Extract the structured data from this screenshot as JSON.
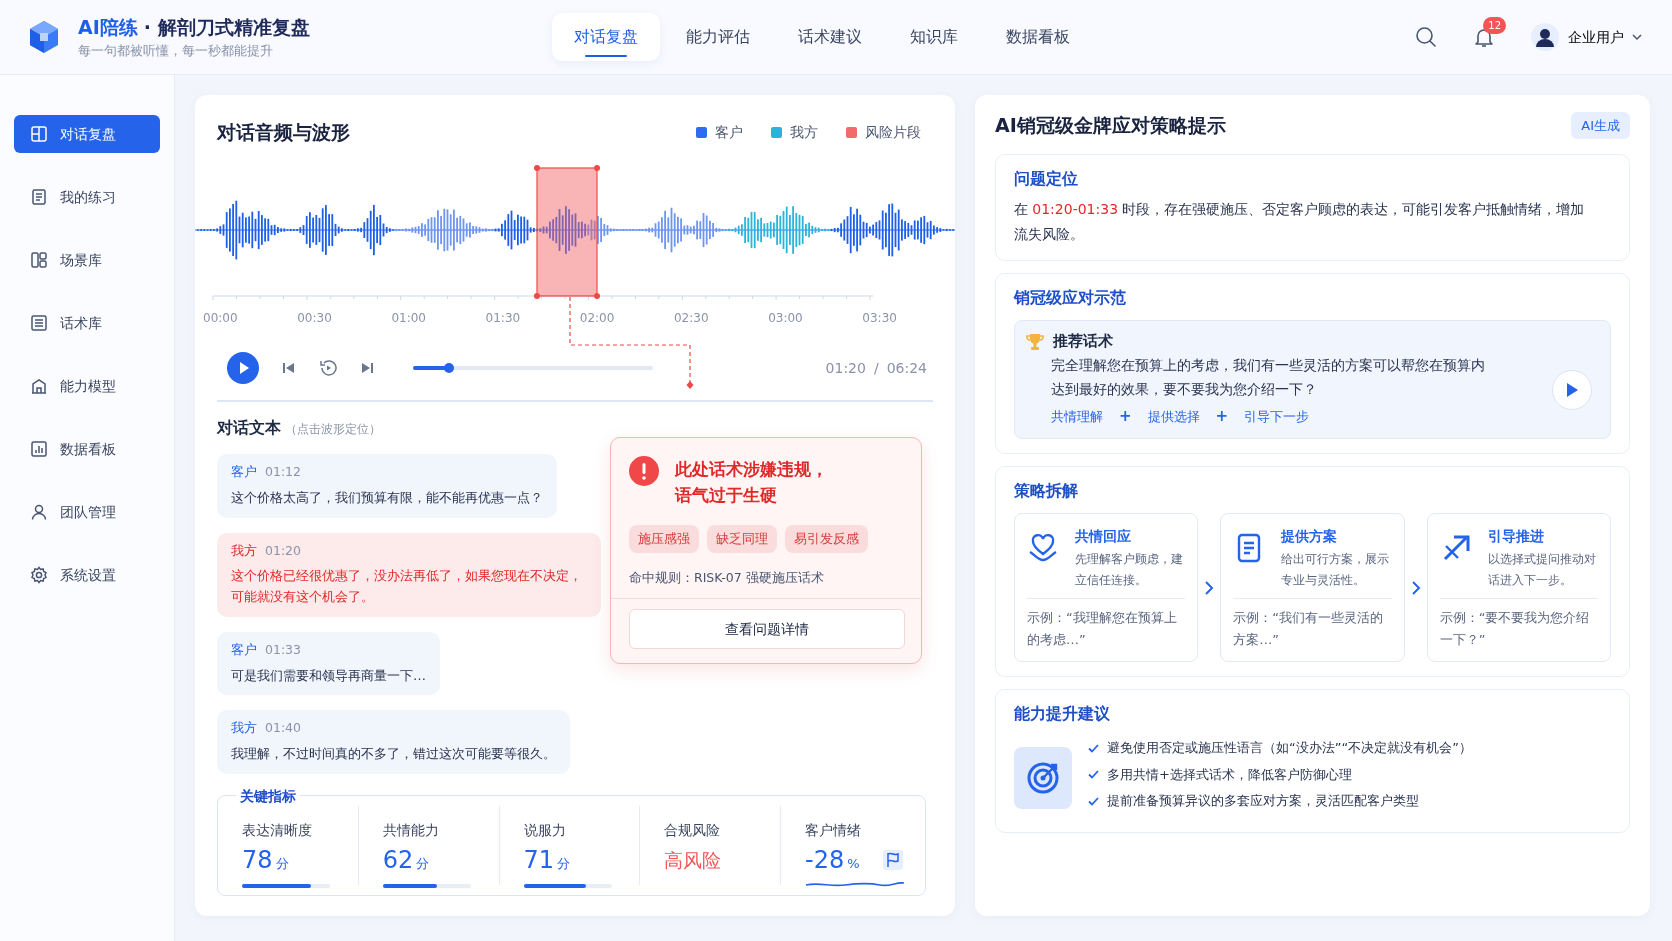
{
  "header": {
    "brand": "AI陪练",
    "title": "· 解剖刀式精准复盘",
    "subtitle": "每一句都被听懂，每一秒都能提升",
    "tabs": [
      {
        "label": "对话复盘",
        "selected": true
      },
      {
        "label": "能力评估",
        "selected": false
      },
      {
        "label": "话术建议",
        "selected": false
      },
      {
        "label": "知识库",
        "selected": false
      },
      {
        "label": "数据看板",
        "selected": false
      }
    ],
    "notification_count": "12",
    "user": "企业用户"
  },
  "sidebar": {
    "items": [
      {
        "label": "对话复盘",
        "selected": true
      },
      {
        "label": "我的练习",
        "selected": false
      },
      {
        "label": "场景库",
        "selected": false
      },
      {
        "label": "话术库",
        "selected": false
      },
      {
        "label": "能力模型",
        "selected": false
      },
      {
        "label": "数据看板",
        "selected": false
      },
      {
        "label": "团队管理",
        "selected": false
      },
      {
        "label": "系统设置",
        "selected": false
      }
    ]
  },
  "audio_panel": {
    "title": "对话音频与波形",
    "legend": [
      {
        "label": "客户",
        "color": "#2f6bf0"
      },
      {
        "label": "我方",
        "color": "#2ab4d9"
      },
      {
        "label": "风险片段",
        "color": "#f26b6b"
      }
    ],
    "timeline": [
      "00:00",
      "00:30",
      "01:00",
      "01:30",
      "02:00",
      "02:30",
      "03:00",
      "03:30"
    ],
    "player": {
      "level": 0.15,
      "current_time": "01:20",
      "separator": "/",
      "total_time": "06:24"
    }
  },
  "transcript": {
    "title": "对话文本",
    "hint": "（点击波形定位）",
    "messages": [
      {
        "speaker": "客户",
        "time": "01:12",
        "text": "这个价格太高了，我们预算有限，能不能再优惠一点？",
        "flagged": false
      },
      {
        "speaker": "我方",
        "time": "01:20",
        "text": "这个价格已经很优惠了，没办法再低了，如果您现在不决定，可能就没有这个机会了。",
        "flagged": true
      },
      {
        "speaker": "客户",
        "time": "01:33",
        "text": "可是我们需要和领导再商量一下…",
        "flagged": false
      },
      {
        "speaker": "我方",
        "time": "01:40",
        "text": "我理解，不过时间真的不多了，错过这次可能要等很久。",
        "flagged": false
      }
    ]
  },
  "risk_popup": {
    "title": "此处话术涉嫌违规，语气过于生硬",
    "tags": [
      "施压感强",
      "缺乏同理",
      "易引发反感"
    ],
    "rule": "命中规则：RISK-07 强硬施压话术",
    "button": "查看问题详情"
  },
  "metrics": {
    "title": "关键指标",
    "items": [
      {
        "kind": "score",
        "label": "表达清晰度",
        "value": "78",
        "unit": "分",
        "level": 0.78
      },
      {
        "kind": "score",
        "label": "共情能力",
        "value": "62",
        "unit": "分",
        "level": 0.62
      },
      {
        "kind": "score",
        "label": "说服力",
        "value": "71",
        "unit": "分",
        "level": 0.71
      },
      {
        "kind": "risk",
        "label": "合规风险",
        "value": "高风险"
      },
      {
        "kind": "trend",
        "label": "客户情绪",
        "value": "-28",
        "unit": "%"
      }
    ]
  },
  "strategy_panel": {
    "title": "AI销冠级金牌应对策略提示",
    "badge": "AI生成",
    "problem": {
      "title": "问题定位",
      "prefix": "在 ",
      "time_range": "01:20-01:33",
      "suffix": " 时段，存在强硬施压、否定客户顾虑的表达，可能引发客户抵触情绪，增加流失风险。"
    },
    "demo": {
      "title": "销冠级应对示范",
      "card_title": "推荐话术",
      "text": "完全理解您在预算上的考虑，我们有一些灵活的方案可以帮您在预算内达到最好的效果，要不要我为您介绍一下？",
      "steps": [
        {
          "kind": "step",
          "text": "共情理解"
        },
        {
          "kind": "plus",
          "text": "+"
        },
        {
          "kind": "step",
          "text": "提供选择"
        },
        {
          "kind": "plus",
          "text": "+"
        },
        {
          "kind": "step",
          "text": "引导下一步"
        }
      ]
    },
    "breakdown": {
      "title": "策略拆解",
      "cards": [
        {
          "title": "共情回应",
          "desc": "先理解客户顾虑，建立信任连接。",
          "example": "示例：“我理解您在预算上的考虑…”"
        },
        {
          "title": "提供方案",
          "desc": "给出可行方案，展示专业与灵活性。",
          "example": "示例：“我们有一些灵活的方案…”"
        },
        {
          "title": "引导推进",
          "desc": "以选择式提问推动对话进入下一步。",
          "example": "示例：“要不要我为您介绍一下？”"
        }
      ]
    },
    "suggestions": {
      "title": "能力提升建议",
      "items": [
        "避免使用否定或施压性语言（如“没办法”“不决定就没有机会”）",
        "多用共情+选择式话术，降低客户防御心理",
        "提前准备预算异议的多套应对方案，灵活匹配客户类型"
      ]
    }
  }
}
